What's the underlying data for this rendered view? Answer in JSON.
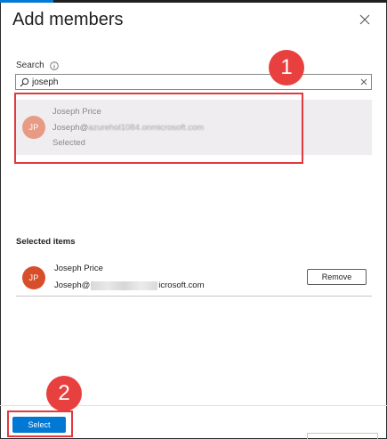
{
  "dialog": {
    "title": "Add members",
    "close_icon": "close-icon"
  },
  "search": {
    "label": "Search",
    "value": "joseph",
    "info_icon": "info-icon",
    "search_icon": "magnifier-icon",
    "clear_icon": "clear-icon"
  },
  "results": [
    {
      "initials": "JP",
      "name": "Joseph Price",
      "email_prefix": "Joseph@",
      "email_obscured": "azurehol1084.onmicrosoft.com",
      "status": "Selected",
      "avatar_color": "#e79b85"
    }
  ],
  "selected_items": {
    "heading": "Selected items",
    "items": [
      {
        "initials": "JP",
        "name": "Joseph Price",
        "email_prefix": "Joseph@",
        "email_suffix": "icrosoft.com",
        "remove_label": "Remove",
        "avatar_color": "#d74f2a"
      }
    ]
  },
  "footer": {
    "select_label": "Select"
  },
  "annotations": [
    {
      "number": "1",
      "color": "#e0393e"
    },
    {
      "number": "2",
      "color": "#e0393e"
    }
  ],
  "colors": {
    "accent": "#0078d4",
    "selection_background": "#efedf0",
    "annotation_red": "#e8403f"
  }
}
